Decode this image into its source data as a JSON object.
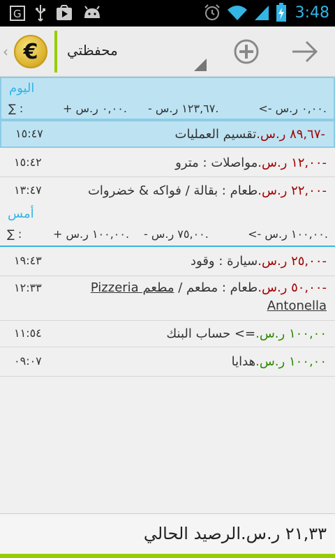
{
  "status_bar": {
    "time": "3:48",
    "left_icons": [
      "g-notification-icon",
      "usb-icon",
      "play-store-icon",
      "android-debug-icon"
    ],
    "right_icons": [
      "alarm-icon",
      "wifi-icon",
      "signal-icon",
      "battery-charging-icon"
    ]
  },
  "action_bar": {
    "wallet_name": "محفظتي",
    "currency_symbol": "€"
  },
  "today": {
    "title": "اليوم",
    "sigma": "∑ :",
    "sum_income": "<- ٠,٠٠ ر.س.",
    "sum_expense": "- ١٢٣,٦٧ ر.س.",
    "sum_balance": "+ ٠,٠٠ ر.س."
  },
  "today_rows": [
    {
      "time": "١٥:٤٧",
      "amount": "-٨٩,٦٧ ر.س.",
      "text": "تقسيم العمليات",
      "sign": "neg"
    },
    {
      "time": "١٥:٤٢",
      "amount": "-١٢,٠٠ ر.س.",
      "text": "مواصلات : مترو",
      "sign": "neg"
    },
    {
      "time": "١٣:٤٧",
      "amount": "-٢٢,٠٠ ر.س.",
      "text": "طعام : بقالة / فواكه & خضروات",
      "sign": "neg"
    }
  ],
  "yesterday": {
    "title": "أمس",
    "sigma": "∑ :",
    "sum_income": "<- ١٠٠,٠٠ ر.س.",
    "sum_expense": "- ٧٥,٠٠ ر.س.",
    "sum_balance": "+ ١٠٠,٠٠ ر.س."
  },
  "yesterday_rows": [
    {
      "time": "١٩:٤٣",
      "amount": "-٢٥,٠٠ ر.س.",
      "text": "سيارة : وقود",
      "sign": "neg"
    },
    {
      "time": "١٢:٣٣",
      "amount": "-٥٠,٠٠ ر.س.",
      "text": "طعام : مطعم / ",
      "link": "مطعم Pizzeria Antonella",
      "sign": "neg"
    },
    {
      "time": "١١:٥٤",
      "amount": "١٠٠,٠٠ ر.س.",
      "text": "=> حساب البنك",
      "sign": "pos"
    },
    {
      "time": "٠٩:٠٧",
      "amount": "١٠٠,٠٠ ر.س.",
      "text": "هدايا",
      "sign": "pos"
    }
  ],
  "footer": {
    "balance_amount": "٢١,٣٣ ر.س.",
    "balance_label": "الرصيد الحالي"
  },
  "colors": {
    "accent_blue": "#33b5e5",
    "accent_green": "#99cc00",
    "negative": "#a40000",
    "positive": "#2b8a00"
  }
}
